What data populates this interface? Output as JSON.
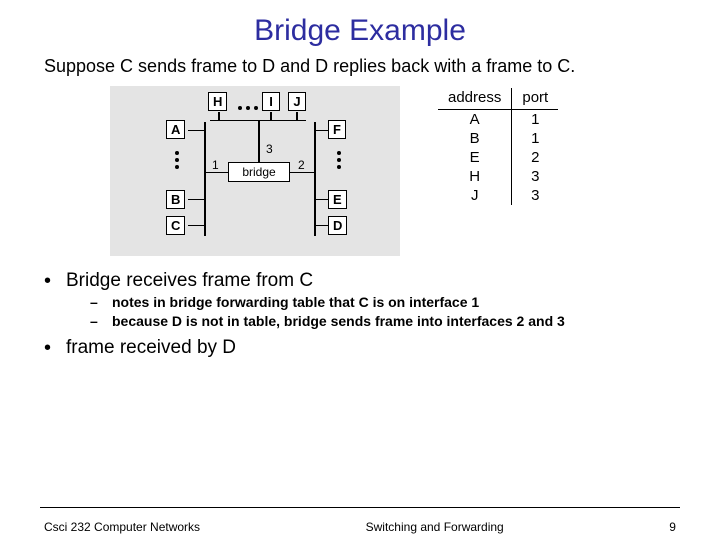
{
  "title": "Bridge Example",
  "intro": "Suppose C sends frame to D and D replies back with a frame to C.",
  "diagram": {
    "nodes": {
      "A": "A",
      "B": "B",
      "C": "C",
      "D": "D",
      "E": "E",
      "F": "F",
      "H": "H",
      "I": "I",
      "J": "J"
    },
    "bridge_label": "bridge",
    "port_labels": {
      "p1": "1",
      "p2": "2",
      "p3": "3"
    }
  },
  "fwd_table": {
    "headers": {
      "address": "address",
      "port": "port"
    },
    "rows": [
      {
        "addr": "A",
        "port": "1"
      },
      {
        "addr": "B",
        "port": "1"
      },
      {
        "addr": "E",
        "port": "2"
      },
      {
        "addr": "H",
        "port": "3"
      },
      {
        "addr": "J",
        "port": "3"
      }
    ]
  },
  "bullets": {
    "b1": "Bridge receives frame from C",
    "b1_sub1": "notes in bridge forwarding table that C is on interface 1",
    "b1_sub2": "because D is not in table, bridge sends frame into interfaces 2 and 3",
    "b2": "frame received by D"
  },
  "footer": {
    "left": "Csci 232 Computer Networks",
    "center": "Switching and Forwarding",
    "right": "9"
  }
}
